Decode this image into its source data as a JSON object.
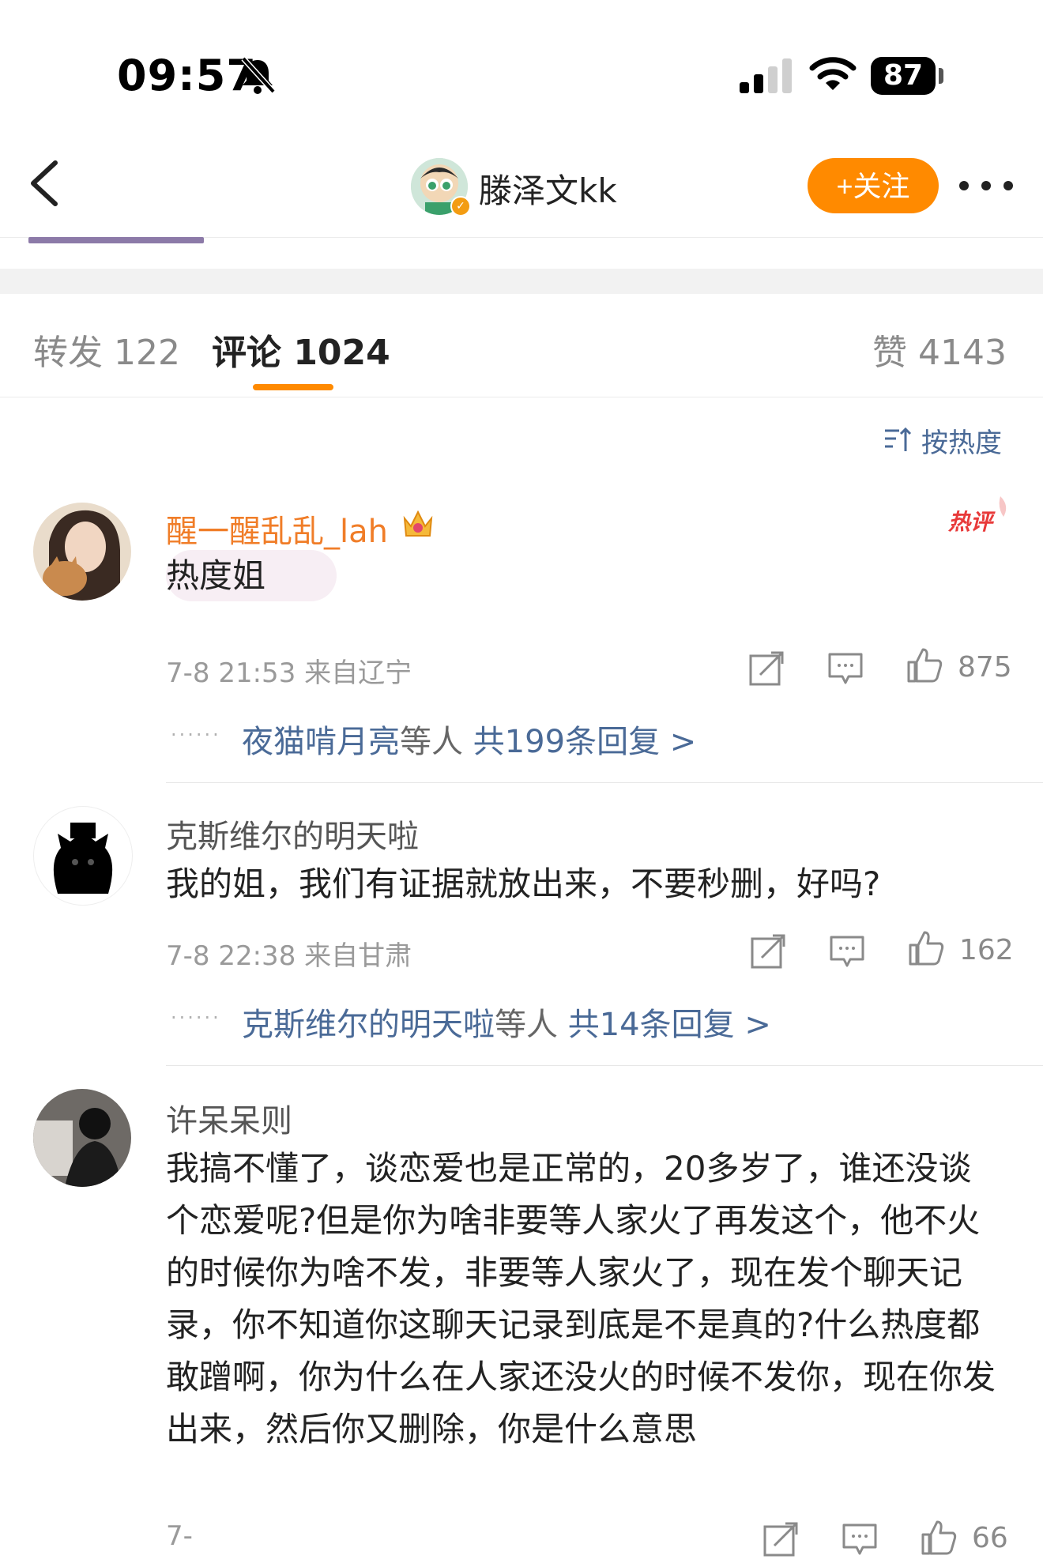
{
  "status_bar": {
    "time": "09:57",
    "battery": "87"
  },
  "header": {
    "name": "滕泽文kk",
    "follow_label": "+关注"
  },
  "tabs": [
    {
      "label": "转发 122"
    },
    {
      "label": "评论 1024"
    },
    {
      "label": "赞 4143"
    }
  ],
  "sort_label": "按热度",
  "comments": [
    {
      "user": "醒一醒乱乱_lah",
      "text": "热度姐",
      "meta": "7-8 21:53 来自辽宁",
      "likes": "875",
      "reply_users": "夜猫啃月亮",
      "reply_mid": "等人",
      "reply_total": "共199条回复 >",
      "badge": "热评"
    },
    {
      "user": "克斯维尔的明天啦",
      "text": "我的姐，我们有证据就放出来，不要秒删，好吗?",
      "meta": "7-8 22:38 来自甘肃",
      "likes": "162",
      "reply_users": "克斯维尔的明天啦",
      "reply_mid": "等人",
      "reply_total": "共14条回复 >"
    },
    {
      "user": "许呆呆则",
      "text": "我搞不懂了，谈恋爱也是正常的，20多岁了，谁还没谈个恋爱呢?但是你为啥非要等人家火了再发这个，他不火的时候你为啥不发，非要等人家火了，现在发个聊天记录，你不知道你这聊天记录到底是不是真的?什么热度都敢蹭啊，你为什么在人家还没火的时候不发你，现在你发出来，然后你又删除，你是什么意思",
      "meta": "7-",
      "likes": "66"
    }
  ],
  "colors": {
    "accent": "#ff8a00",
    "link": "#4a6a97",
    "vip_name": "#f07d28"
  }
}
